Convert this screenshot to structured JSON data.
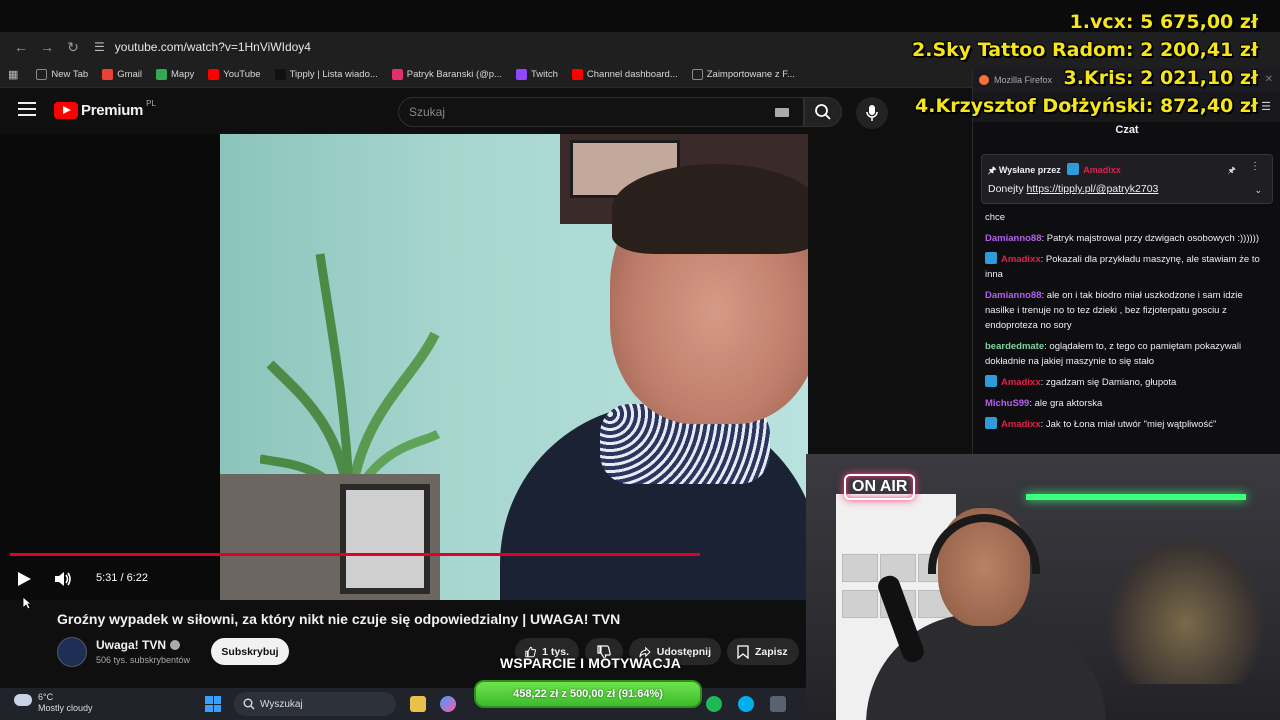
{
  "browser": {
    "url": "youtube.com/watch?v=1HnViWIdoy4",
    "bookmarks": [
      {
        "label": "New Tab",
        "color": "#1f1f1f"
      },
      {
        "label": "Gmail",
        "color": "#ea4335"
      },
      {
        "label": "Mapy",
        "color": "#34a853"
      },
      {
        "label": "YouTube",
        "color": "#ff0000"
      },
      {
        "label": "Tipply | Lista wiado...",
        "color": "#111111"
      },
      {
        "label": "Patryk Baranski (@p...",
        "color": "#e1306c"
      },
      {
        "label": "Twitch",
        "color": "#9146ff"
      },
      {
        "label": "Channel dashboard...",
        "color": "#ff0000"
      },
      {
        "label": "Zaimportowane z F...",
        "color": "#1f1f1f"
      }
    ]
  },
  "youtube": {
    "logo_text": "Premium",
    "region": "PL",
    "search_placeholder": "Szukaj"
  },
  "player": {
    "time": "5:31 / 6:22",
    "progress": 0.867
  },
  "video": {
    "title": "Groźny wypadek w siłowni, za który nikt nie czuje się odpowiedzialny | UWAGA! TVN",
    "channel_name": "Uwaga! TVN",
    "subscribers": "506 tys. subskrybentów",
    "subscribe_label": "Subskrybuj",
    "likes": "1 tys.",
    "share_label": "Udostępnij",
    "save_label": "Zapisz"
  },
  "overlay": {
    "leaderboard": [
      {
        "rank": "1.",
        "name": "vcx:",
        "amount": "5 675,00 zł"
      },
      {
        "rank": "2.",
        "name": "Sky Tattoo Radom:",
        "amount": "2 200,41 zł"
      },
      {
        "rank": "3.",
        "name": "Kris:",
        "amount": "2 021,10 zł"
      },
      {
        "rank": "4.",
        "name": "Krzysztof Dołżyński:",
        "amount": "872,40 zł"
      }
    ],
    "goal_label": "WSPARCIE I MOTYWACJA",
    "goal_progress": "458,22 zł z 500,00 zł (91.64%)",
    "on_air": "ON AIR"
  },
  "chat": {
    "firefox_title": "Mozilla Firefox",
    "header": "Czat",
    "pinned_by_label": "Wysłane przez",
    "pinned_by_user": "Amadixx",
    "pinned_text": "Donejty ",
    "pinned_link": "https://tipply.pl/@patryk2703",
    "messages": [
      {
        "user": "",
        "color": "#efeff1",
        "badge": false,
        "text": "chce"
      },
      {
        "user": "Damianno88",
        "color": "#b45ff0",
        "badge": false,
        "text": "Patryk majstrowal przy dzwigach osobowych :))))))"
      },
      {
        "user": "Amadixx",
        "color": "#e0204a",
        "badge": true,
        "text": "Pokazali dla przykładu maszynę, ale stawiam że to inna"
      },
      {
        "user": "Damianno88",
        "color": "#b45ff0",
        "badge": false,
        "text": "ale on i tak biodro miał uszkodzone i sam idzie nasilke i trenuje no to tez dzieki , bez fizjoterpatu gosciu z endoproteza no sory"
      },
      {
        "user": "beardedmate",
        "color": "#7fd3a0",
        "badge": false,
        "text": "oglądałem to, z tego co pamiętam pokazywali dokładnie na jakiej maszynie to się stało"
      },
      {
        "user": "Amadixx",
        "color": "#e0204a",
        "badge": true,
        "text": "zgadzam się Damiano, głupota"
      },
      {
        "user": "MichuS99",
        "color": "#b45ff0",
        "badge": false,
        "text": "ale gra aktorska"
      },
      {
        "user": "Amadixx",
        "color": "#e0204a",
        "badge": true,
        "text": "Jak to Łona miał utwór \"miej wątpliwość\""
      }
    ]
  },
  "taskbar": {
    "temperature": "6°C",
    "weather": "Mostly cloudy",
    "search_label": "Wyszukaj"
  }
}
